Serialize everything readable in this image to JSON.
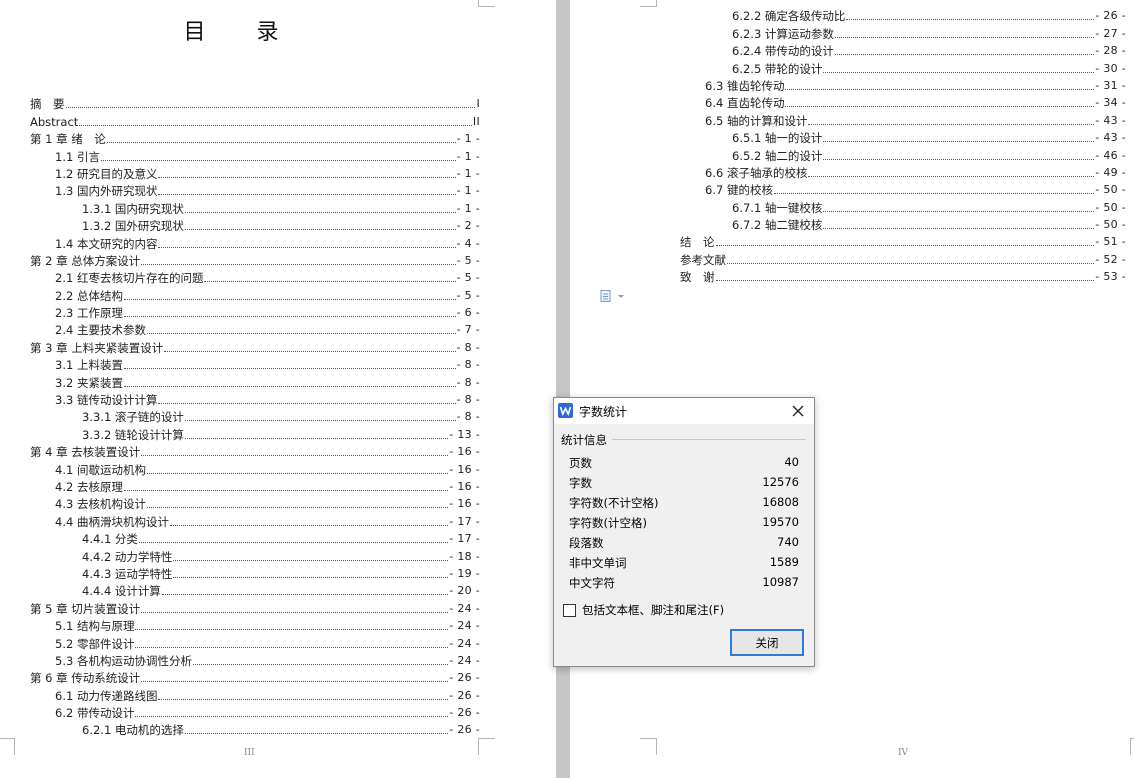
{
  "left_page": {
    "title": "目 录",
    "page_number": "III",
    "entries": [
      {
        "text": "摘　要",
        "page": "I",
        "level": 1
      },
      {
        "text": "Abstract",
        "page": "II",
        "level": 1
      },
      {
        "text": "第 1 章  绪　论",
        "page": "- 1 -",
        "level": 1
      },
      {
        "text": "1.1 引言",
        "page": "- 1 -",
        "level": 2
      },
      {
        "text": "1.2 研究目的及意义",
        "page": "- 1 -",
        "level": 2
      },
      {
        "text": "1.3 国内外研究现状",
        "page": "- 1 -",
        "level": 2
      },
      {
        "text": "1.3.1 国内研究现状",
        "page": "- 1 -",
        "level": 3
      },
      {
        "text": "1.3.2 国外研究现状",
        "page": "- 2 -",
        "level": 3
      },
      {
        "text": "1.4 本文研究的内容",
        "page": "- 4 -",
        "level": 2
      },
      {
        "text": "第 2 章  总体方案设计",
        "page": "- 5 -",
        "level": 1
      },
      {
        "text": "2.1 红枣去核切片存在的问题",
        "page": "- 5 -",
        "level": 2
      },
      {
        "text": "2.2 总体结构",
        "page": "- 5 -",
        "level": 2
      },
      {
        "text": "2.3 工作原理",
        "page": "- 6 -",
        "level": 2
      },
      {
        "text": "2.4 主要技术参数",
        "page": "- 7 -",
        "level": 2
      },
      {
        "text": "第 3 章  上料夹紧装置设计",
        "page": "- 8 -",
        "level": 1
      },
      {
        "text": "3.1 上料装置",
        "page": "- 8 -",
        "level": 2
      },
      {
        "text": "3.2 夹紧装置",
        "page": "- 8 -",
        "level": 2
      },
      {
        "text": "3.3 链传动设计计算",
        "page": "- 8 -",
        "level": 2
      },
      {
        "text": "3.3.1 滚子链的设计",
        "page": "- 8 -",
        "level": 3
      },
      {
        "text": "3.3.2 链轮设计计算",
        "page": "- 13 -",
        "level": 3
      },
      {
        "text": "第 4 章  去核装置设计",
        "page": "- 16 -",
        "level": 1
      },
      {
        "text": "4.1 间歇运动机构",
        "page": "- 16 -",
        "level": 2
      },
      {
        "text": "4.2 去核原理",
        "page": "- 16 -",
        "level": 2
      },
      {
        "text": "4.3 去核机构设计",
        "page": "- 16 -",
        "level": 2
      },
      {
        "text": "4.4 曲柄滑块机构设计",
        "page": "- 17 -",
        "level": 2
      },
      {
        "text": "4.4.1 分类",
        "page": "- 17 -",
        "level": 3
      },
      {
        "text": "4.4.2 动力学特性",
        "page": "- 18 -",
        "level": 3
      },
      {
        "text": "4.4.3 运动学特性",
        "page": "- 19 -",
        "level": 3
      },
      {
        "text": "4.4.4 设计计算",
        "page": "- 20 -",
        "level": 3
      },
      {
        "text": "第 5 章  切片装置设计",
        "page": "- 24 -",
        "level": 1
      },
      {
        "text": "5.1 结构与原理",
        "page": "- 24 -",
        "level": 2
      },
      {
        "text": "5.2 零部件设计",
        "page": "- 24 -",
        "level": 2
      },
      {
        "text": "5.3 各机构运动协调性分析",
        "page": "- 24 -",
        "level": 2
      },
      {
        "text": "第 6 章  传动系统设计",
        "page": "- 26 -",
        "level": 1
      },
      {
        "text": "6.1 动力传递路线图",
        "page": "- 26 -",
        "level": 2
      },
      {
        "text": "6.2 带传动设计",
        "page": "- 26 -",
        "level": 2
      },
      {
        "text": "6.2.1 电动机的选择",
        "page": "- 26 -",
        "level": 3
      }
    ]
  },
  "right_page": {
    "page_number": "IV",
    "entries": [
      {
        "text": "6.2.2 确定各级传动比",
        "page": "- 26 -",
        "level": 3
      },
      {
        "text": "6.2.3 计算运动参数",
        "page": "- 27 -",
        "level": 3
      },
      {
        "text": "6.2.4 带传动的设计",
        "page": "- 28 -",
        "level": 3
      },
      {
        "text": "6.2.5 带轮的设计",
        "page": "- 30 -",
        "level": 3
      },
      {
        "text": "6.3 锥齿轮传动",
        "page": "- 31 -",
        "level": 2
      },
      {
        "text": "6.4 直齿轮传动",
        "page": "- 34 -",
        "level": 2
      },
      {
        "text": "6.5 轴的计算和设计",
        "page": "- 43 -",
        "level": 2
      },
      {
        "text": "6.5.1 轴一的设计",
        "page": "- 43 -",
        "level": 3
      },
      {
        "text": "6.5.2 轴二的设计",
        "page": "- 46 -",
        "level": 3
      },
      {
        "text": "6.6 滚子轴承的校核",
        "page": "- 49 -",
        "level": 2
      },
      {
        "text": "6.7 键的校核",
        "page": "- 50 -",
        "level": 2
      },
      {
        "text": "6.7.1 轴一键校核",
        "page": "- 50 -",
        "level": 3
      },
      {
        "text": "6.7.2 轴二键校核",
        "page": "- 50 -",
        "level": 3
      },
      {
        "text": "结　论",
        "page": "- 51 -",
        "level": 1
      },
      {
        "text": "参考文献",
        "page": "- 52 -",
        "level": 1
      },
      {
        "text": "致　谢",
        "page": "- 53 -",
        "level": 1
      }
    ]
  },
  "dialog": {
    "title": "字数统计",
    "group_label": "统计信息",
    "stats": [
      {
        "label": "页数",
        "value": "40"
      },
      {
        "label": "字数",
        "value": "12576"
      },
      {
        "label": "字符数(不计空格)",
        "value": "16808"
      },
      {
        "label": "字符数(计空格)",
        "value": "19570"
      },
      {
        "label": "段落数",
        "value": "740"
      },
      {
        "label": "非中文单词",
        "value": "1589"
      },
      {
        "label": "中文字符",
        "value": "10987"
      }
    ],
    "checkbox_label": "包括文本框、脚注和尾注(F)",
    "checkbox_checked": false,
    "close_button_label": "关闭",
    "accent_color": "#2f7bd8"
  }
}
